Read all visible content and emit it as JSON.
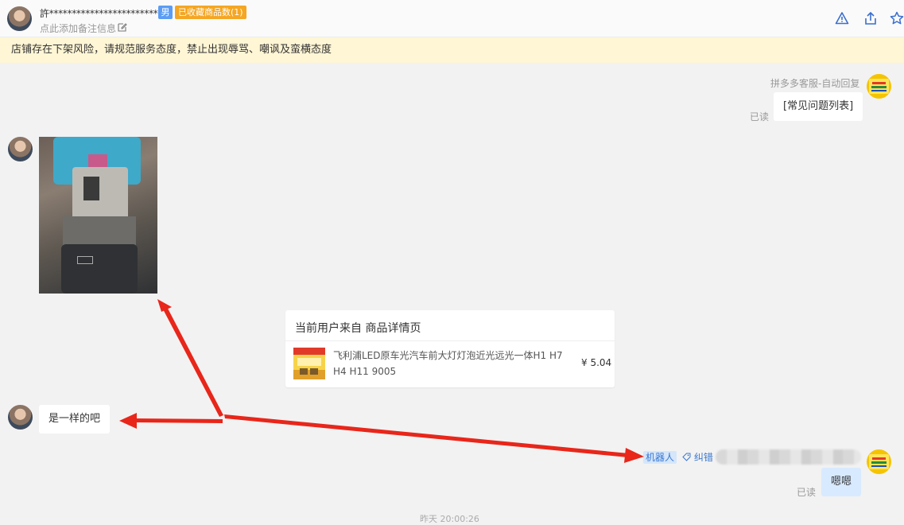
{
  "header": {
    "username": "許*************************8",
    "gender": "男",
    "favorites_badge": "已收藏商品数(1)",
    "remark_placeholder": "点此添加备注信息"
  },
  "notice": "店铺存在下架风险，请规范服务态度，禁止出现辱骂、嘲讽及蛮横态度",
  "messages": {
    "auto_reply_sender": "拼多多客服-自动回复",
    "auto_reply_text": "[常见问题列表]",
    "read_1": "已读",
    "product_card": {
      "title": "当前用户来自 商品详情页",
      "product_name": "飞利浦LED原车光汽车前大灯灯泡近光远光一体H1 H7 H4 H11 9005",
      "price": "¥ 5.04"
    },
    "customer_text": "是一样的吧",
    "robot_tag": "机器人",
    "correct_label": "纠错",
    "reply_text": "嗯嗯",
    "read_2": "已读",
    "timestamp": "昨天 20:00:26"
  },
  "colors": {
    "notice_bg": "#fff6d5",
    "gender_badge": "#5b9cf5",
    "favorites_badge": "#f5a623",
    "link_blue": "#3a78d0",
    "reply_bubble": "#d8eaff",
    "arrow_red": "#e8261a"
  },
  "icons": [
    "edit-icon",
    "warning-icon",
    "share-icon",
    "star-icon",
    "tag-icon"
  ]
}
